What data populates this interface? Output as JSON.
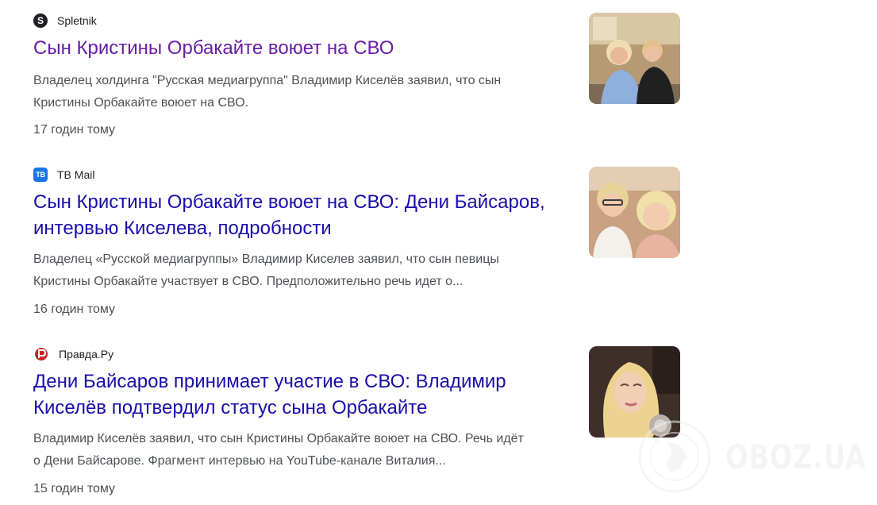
{
  "results": [
    {
      "source": "Spletnik",
      "favicon": "spletnik-logo-icon",
      "title": "Сын Кристины Орбакайте воюет на СВО",
      "visited": true,
      "snippet_lines": [
        "Владелец холдинга \"Русская медиагруппа\" Владимир Киселёв заявил, что сын",
        "Кристины Орбакайте воюет на СВО."
      ],
      "time": "17 годин тому",
      "thumbnail": "photo-woman-and-young-man"
    },
    {
      "source": "ТВ Mail",
      "favicon": "tb-mail-logo-icon",
      "favicon_text": "ТВ",
      "title_lines": [
        "Сын Кристины Орбакайте воюет на СВО: Дени Байсаров,",
        "интервью Киселева, подробности"
      ],
      "visited": false,
      "snippet_lines": [
        "Владелец «Русской медиагруппы» Владимир Киселев заявил, что сын певицы",
        "Кристины Орбакайте участвует в СВО. Предположительно речь идет о..."
      ],
      "time": "16 годин тому",
      "thumbnail": "photo-selfie-young-man-and-woman"
    },
    {
      "source": "Правда.Ру",
      "favicon": "pravda-logo-icon",
      "title_lines": [
        "Дени Байсаров принимает участие в СВО: Владимир",
        "Киселёв подтвердил статус сына Орбакайте"
      ],
      "visited": false,
      "snippet_lines": [
        "Владимир Киселёв заявил, что сын Кристины Орбакайте воюет на СВО. Речь идёт",
        "о Дени Байсарове. Фрагмент интервью на YouTube-канале Виталия..."
      ],
      "time": "15 годин тому",
      "thumbnail": "photo-blonde-woman-portrait"
    }
  ],
  "watermark": {
    "text": "OBOZ.UA",
    "icon": "oboz-globe-icon"
  },
  "colors": {
    "link": "#1a0dab",
    "visited_link": "#681da8",
    "snippet": "#4d5156",
    "source": "#202124"
  }
}
